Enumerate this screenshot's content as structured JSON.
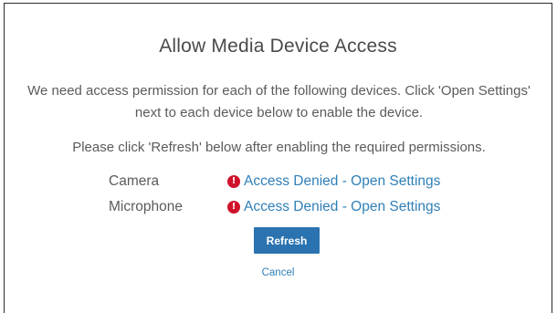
{
  "dialog": {
    "title": "Allow Media Device Access",
    "message_line1": "We need access permission for each of the following devices. Click 'Open Settings' next to each device below to enable the device.",
    "message_line2": "Please click 'Refresh' below after enabling the required permissions.",
    "devices": [
      {
        "name": "Camera",
        "status": "Access Denied - Open Settings",
        "icon": "error-icon",
        "icon_glyph": "!"
      },
      {
        "name": "Microphone",
        "status": "Access Denied - Open Settings",
        "icon": "error-icon",
        "icon_glyph": "!"
      }
    ],
    "refresh_label": "Refresh",
    "cancel_label": "Cancel"
  },
  "colors": {
    "primary_button": "#2a73b0",
    "link": "#2f7fb8",
    "error": "#d0112b",
    "text": "#5b5b5b"
  }
}
